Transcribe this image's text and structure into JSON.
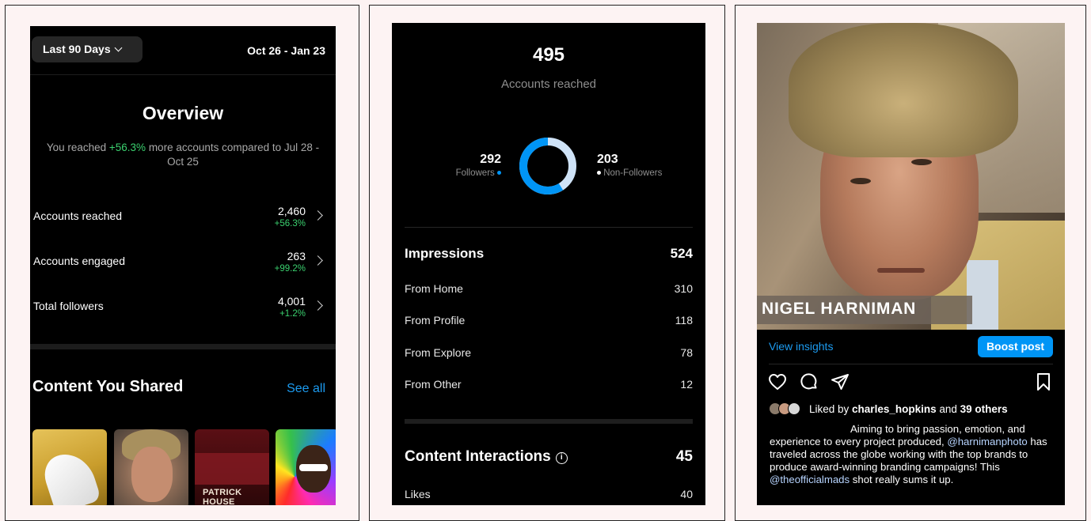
{
  "panel1": {
    "range_button": "Last 90 Days",
    "date_range": "Oct 26 - Jan 23",
    "overview_title": "Overview",
    "desc_before": "You reached ",
    "desc_pct": "+56.3%",
    "desc_after": " more accounts compared to Jul 28 - Oct 25",
    "metrics": [
      {
        "label": "Accounts reached",
        "value": "2,460",
        "change": "+56.3%"
      },
      {
        "label": "Accounts engaged",
        "value": "263",
        "change": "+99.2%"
      },
      {
        "label": "Total followers",
        "value": "4,001",
        "change": "+1.2%"
      }
    ],
    "content_title": "Content You Shared",
    "see_all": "See all",
    "thumb3_label": "PATRICK HOUSE"
  },
  "panel2": {
    "accounts_reached_value": "495",
    "accounts_reached_label": "Accounts reached",
    "followers_value": "292",
    "followers_label": "Followers",
    "non_followers_value": "203",
    "non_followers_label": "Non-Followers",
    "followers_fraction": 0.59,
    "impressions": {
      "label": "Impressions",
      "value": "524"
    },
    "impression_rows": [
      {
        "label": "From Home",
        "value": "310"
      },
      {
        "label": "From Profile",
        "value": "118"
      },
      {
        "label": "From Explore",
        "value": "78"
      },
      {
        "label": "From Other",
        "value": "12"
      }
    ],
    "content_interactions": {
      "label": "Content Interactions",
      "value": "45"
    },
    "likes": {
      "label": "Likes",
      "value": "40"
    },
    "colors": {
      "followers": "#0095f6",
      "non_followers": "#cfe3f7"
    }
  },
  "panel3": {
    "name_overlay": "NIGEL HARNIMAN",
    "view_insights": "View insights",
    "boost_post": "Boost post",
    "liked_by_prefix": "Liked by ",
    "liked_by_user": "charles_hopkins",
    "liked_by_mid": " and ",
    "liked_by_others": "39 others",
    "caption_1": "Aiming to bring passion, emotion, and experience to every project produced,",
    "caption_mention1": "@harnimanphoto",
    "caption_2": " has traveled across the globe working with the top brands to produce award-winning branding campaigns! This ",
    "caption_mention2": "@theofficialmads",
    "caption_3": " shot really sums it up.",
    "icons": [
      "heart-icon",
      "comment-icon",
      "share-icon",
      "bookmark-icon"
    ]
  }
}
